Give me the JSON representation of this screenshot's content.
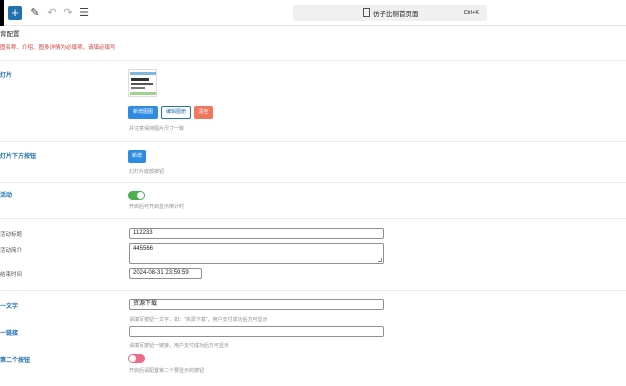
{
  "toolbar": {
    "command_title": "仿子比侧首页面",
    "shortcut": "Ctrl+K"
  },
  "section": {
    "title": "背配置",
    "notice": "图名称、介绍、图多详情为必填项，请填必填写"
  },
  "slide": {
    "label": "灯片",
    "buttons": {
      "upload": "新增图图",
      "edit": "编辑图册",
      "clear": "清空"
    },
    "desc": "并注意保持图片尺寸一致"
  },
  "slide_buttons": {
    "label": "灯片下方按钮",
    "add": "新增",
    "desc": "幻灯片底部按钮"
  },
  "activity": {
    "label": "活动",
    "toggle_on": true,
    "desc": "开启后可开启显示倒计时",
    "fields": {
      "title_label": "活动标题",
      "title_value": "112233",
      "intro_label": "活动简介",
      "intro_value": "445566",
      "end_label": "结束时间",
      "end_value": "2024-08-31 23:59:59"
    }
  },
  "button1": {
    "text_label": "一文字",
    "text_value": "资源下载",
    "text_desc": "请填写按钮一文字，如：\"资源下载\"，用户支付成功后方可显示",
    "link_label": "一链接",
    "link_value": "",
    "link_desc": "请填写按钮一链接，用户支付成功后方可显示"
  },
  "button2": {
    "label": "第二个按钮",
    "toggle_on": false,
    "desc": "开启后请配置第二个要显示的按钮"
  }
}
